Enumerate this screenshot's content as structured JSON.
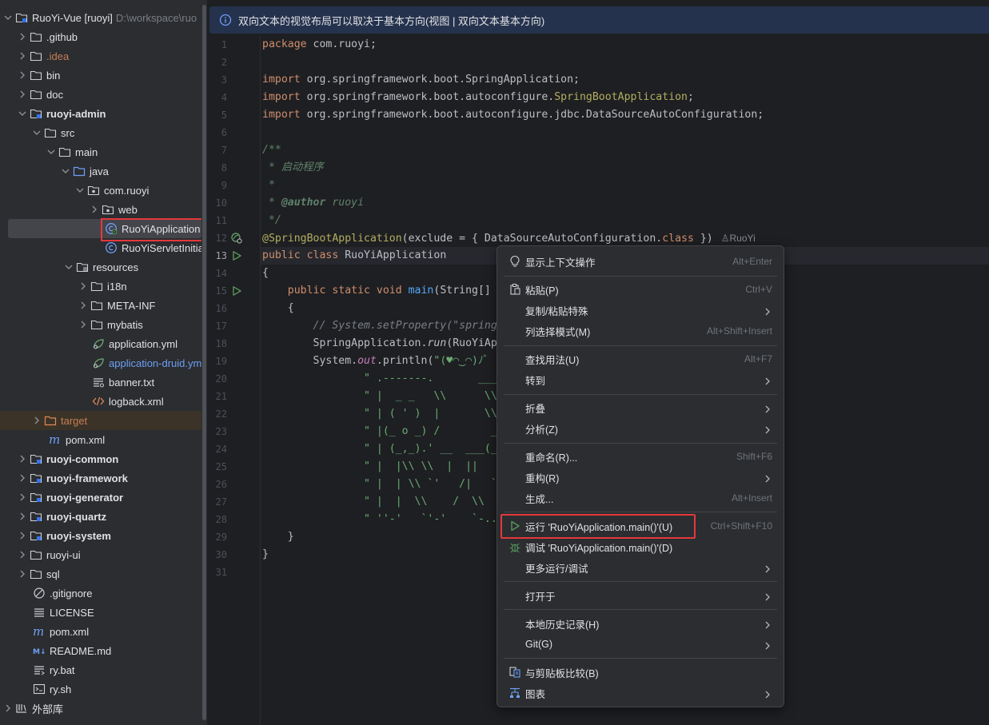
{
  "banner": {
    "text": "双向文本的视觉布局可以取决于基本方向(视图 | 双向文本基本方向)"
  },
  "tree": {
    "root_label": "RuoYi-Vue [ruoyi]",
    "root_path": "D:\\workspace\\ruo",
    "items": [
      {
        "label": "RuoYi-Vue [ruoyi]"
      },
      {
        "label": ".github"
      },
      {
        "label": ".idea"
      },
      {
        "label": "bin"
      },
      {
        "label": "doc"
      },
      {
        "label": "ruoyi-admin"
      },
      {
        "label": "src"
      },
      {
        "label": "main"
      },
      {
        "label": "java"
      },
      {
        "label": "com.ruoyi"
      },
      {
        "label": "web"
      },
      {
        "label": "RuoYiApplication"
      },
      {
        "label": "RuoYiServletInitial"
      },
      {
        "label": "resources"
      },
      {
        "label": "i18n"
      },
      {
        "label": "META-INF"
      },
      {
        "label": "mybatis"
      },
      {
        "label": "application.yml"
      },
      {
        "label": "application-druid.yml"
      },
      {
        "label": "banner.txt"
      },
      {
        "label": "logback.xml"
      },
      {
        "label": "target"
      },
      {
        "label": "pom.xml"
      },
      {
        "label": "ruoyi-common"
      },
      {
        "label": "ruoyi-framework"
      },
      {
        "label": "ruoyi-generator"
      },
      {
        "label": "ruoyi-quartz"
      },
      {
        "label": "ruoyi-system"
      },
      {
        "label": "ruoyi-ui"
      },
      {
        "label": "sql"
      },
      {
        "label": ".gitignore"
      },
      {
        "label": "LICENSE"
      },
      {
        "label": "pom.xml"
      },
      {
        "label": "README.md"
      },
      {
        "label": "ry.bat"
      },
      {
        "label": "ry.sh"
      },
      {
        "label": "外部库"
      }
    ]
  },
  "editor": {
    "line_numbers": [
      "1",
      "2",
      "3",
      "4",
      "5",
      "6",
      "7",
      "8",
      "9",
      "10",
      "11",
      "12",
      "13",
      "14",
      "15",
      "16",
      "17",
      "18",
      "19",
      "20",
      "21",
      "22",
      "23",
      "24",
      "25",
      "26",
      "27",
      "28",
      "29",
      "30",
      "31"
    ],
    "author_hint": "RuoYi",
    "lines": {
      "l1_kw": "package",
      "l1_rest": " com.ruoyi;",
      "l3_kw": "import",
      "l3_rest": " org.springframework.boot.SpringApplication;",
      "l4_kw": "import",
      "l4_a": " org.springframework.boot.autoconfigure.",
      "l4_b": "SpringBootApplication",
      "l4_c": ";",
      "l5_kw": "import",
      "l5_rest": " org.springframework.boot.autoconfigure.jdbc.DataSourceAutoConfiguration;",
      "l7": "/**",
      "l8": " * 启动程序",
      "l9": " *",
      "l10_a": " * ",
      "l10_tag": "@author",
      "l10_b": " ruoyi",
      "l11": " */",
      "l12_an": "@SpringBootApplication",
      "l12_a": "(exclude = { DataSourceAutoConfiguration.",
      "l12_kw": "class",
      "l12_b": " })",
      "l13_kw": "public class",
      "l13_rest": " RuoYiApplication",
      "l14": "{",
      "l15_kw": "    public static void",
      "l15_fn": " main",
      "l15_rest": "(String[]",
      "l16": "    {",
      "l17": "        // System.setProperty(\"spring",
      "l18_a": "        SpringApplication.",
      "l18_b": "run",
      "l18_c": "(RuoYiAp",
      "l19_a": "        System.",
      "l19_b": "out",
      "l19_c": ".println(",
      "l19_d": "\"(♥◠‿◠)ﾉﾞ",
      "l20": "                \" .-------.       ____",
      "l21": "                \" |  _ _   \\\\      \\\\",
      "l22": "                \" | ( ' )  |       \\\\",
      "l23": "                \" |(_ o _) /        _",
      "l24": "                \" | (_,_).' __  ___(_",
      "l25": "                \" |  |\\\\ \\\\  |  ||   |",
      "l26": "                \" |  | \\\\ `'   /|   `",
      "l27": "                \" |  |  \\\\    /  \\\\",
      "l28": "                \" ''-'   `'-'    `-..",
      "l29": "    }",
      "l30": "}"
    }
  },
  "menu": {
    "items": [
      {
        "label": "显示上下文操作",
        "shortcut": "Alt+Enter",
        "icon": "bulb-icon"
      },
      {
        "label": "粘贴(P)",
        "shortcut": "Ctrl+V",
        "icon": "paste-icon"
      },
      {
        "label": "复制/粘贴特殊",
        "shortcut": "",
        "icon": ""
      },
      {
        "label": "列选择模式(M)",
        "shortcut": "Alt+Shift+Insert",
        "icon": ""
      },
      {
        "label": "查找用法(U)",
        "shortcut": "Alt+F7",
        "icon": ""
      },
      {
        "label": "转到",
        "shortcut": "",
        "icon": ""
      },
      {
        "label": "折叠",
        "shortcut": "",
        "icon": ""
      },
      {
        "label": "分析(Z)",
        "shortcut": "",
        "icon": ""
      },
      {
        "label": "重命名(R)...",
        "shortcut": "Shift+F6",
        "icon": ""
      },
      {
        "label": "重构(R)",
        "shortcut": "",
        "icon": ""
      },
      {
        "label": "生成...",
        "shortcut": "Alt+Insert",
        "icon": ""
      },
      {
        "label": "运行 'RuoYiApplication.main()'(U)",
        "shortcut": "Ctrl+Shift+F10",
        "icon": "run-icon"
      },
      {
        "label": "调试 'RuoYiApplication.main()'(D)",
        "shortcut": "",
        "icon": "debug-icon"
      },
      {
        "label": "更多运行/调试",
        "shortcut": "",
        "icon": ""
      },
      {
        "label": "打开于",
        "shortcut": "",
        "icon": ""
      },
      {
        "label": "本地历史记录(H)",
        "shortcut": "",
        "icon": ""
      },
      {
        "label": "Git(G)",
        "shortcut": "",
        "icon": ""
      },
      {
        "label": "与剪贴板比较(B)",
        "shortcut": "",
        "icon": "compare-icon"
      },
      {
        "label": "图表",
        "shortcut": "",
        "icon": "diagram-icon"
      }
    ]
  },
  "colors": {
    "highlight_border": "#e5383b",
    "run_green": "#57965c",
    "folder_blue": "#6f9ff5"
  }
}
